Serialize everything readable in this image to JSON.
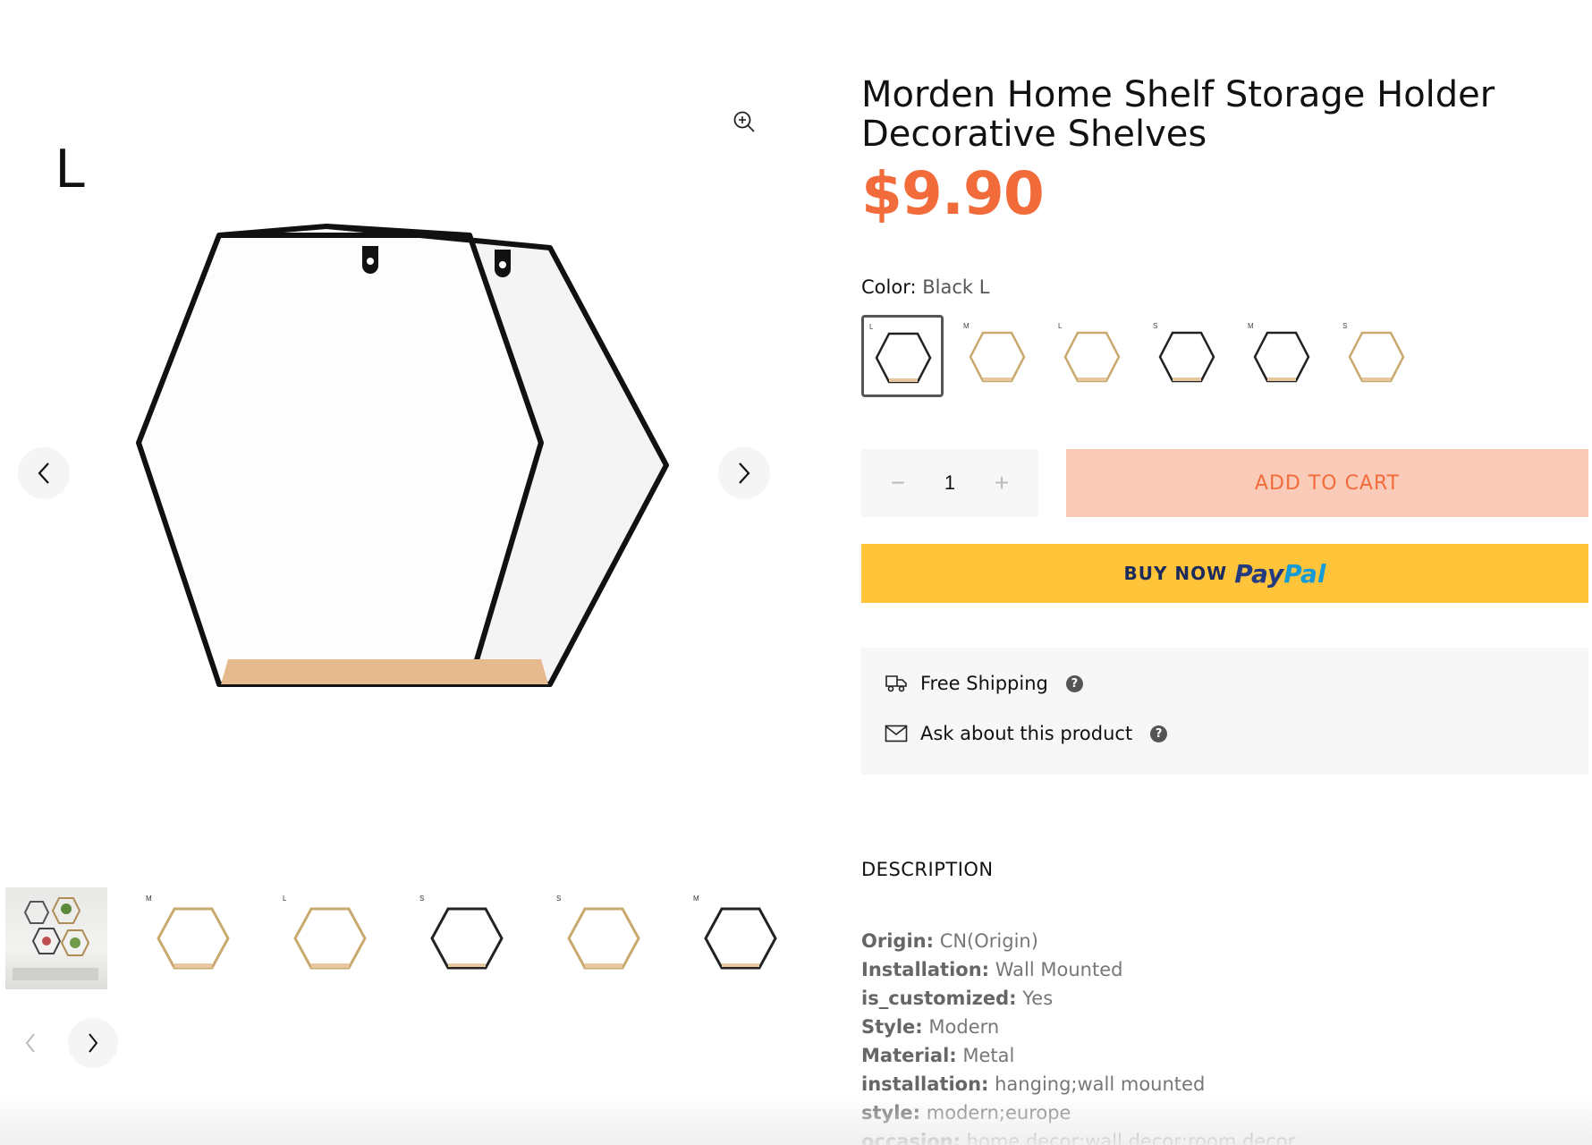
{
  "gallery": {
    "main_size_letter": "L",
    "thumbnails": [
      {
        "label": "",
        "variant": "photo"
      },
      {
        "label": "M",
        "variant": "gold"
      },
      {
        "label": "L",
        "variant": "gold"
      },
      {
        "label": "S",
        "variant": "black"
      },
      {
        "label": "S",
        "variant": "gold"
      },
      {
        "label": "M",
        "variant": "black"
      }
    ]
  },
  "product": {
    "title": "Morden Home Shelf Storage Holder Decorative Shelves",
    "price": "$9.90",
    "price_color": "#f26b3a",
    "color_label": "Color:",
    "color_value": "Black L",
    "swatches": [
      {
        "label": "L",
        "variant": "black",
        "selected": true
      },
      {
        "label": "M",
        "variant": "gold",
        "selected": false
      },
      {
        "label": "L",
        "variant": "gold",
        "selected": false
      },
      {
        "label": "S",
        "variant": "black",
        "selected": false
      },
      {
        "label": "M",
        "variant": "black",
        "selected": false
      },
      {
        "label": "S",
        "variant": "gold",
        "selected": false
      }
    ],
    "quantity": "1",
    "minus": "−",
    "plus": "+",
    "add_to_cart": "ADD TO CART",
    "buy_now": "BUY NOW",
    "paypal_pay": "Pay",
    "paypal_pal": "Pal",
    "paypal_color": "#ffc439"
  },
  "service": {
    "shipping": "Free Shipping",
    "ask": "Ask about this product",
    "help_glyph": "?"
  },
  "description": {
    "heading": "DESCRIPTION",
    "specs": [
      {
        "key": "Origin:",
        "value": "CN(Origin)"
      },
      {
        "key": "Installation:",
        "value": "Wall Mounted"
      },
      {
        "key": "is_customized:",
        "value": "Yes"
      },
      {
        "key": "Style:",
        "value": "Modern"
      },
      {
        "key": "Material:",
        "value": "Metal"
      },
      {
        "key": "installation:",
        "value": "hanging;wall mounted"
      },
      {
        "key": "style:",
        "value": "modern;europe"
      },
      {
        "key": "occasion:",
        "value": "home decor;wall decor;room decor"
      }
    ]
  }
}
